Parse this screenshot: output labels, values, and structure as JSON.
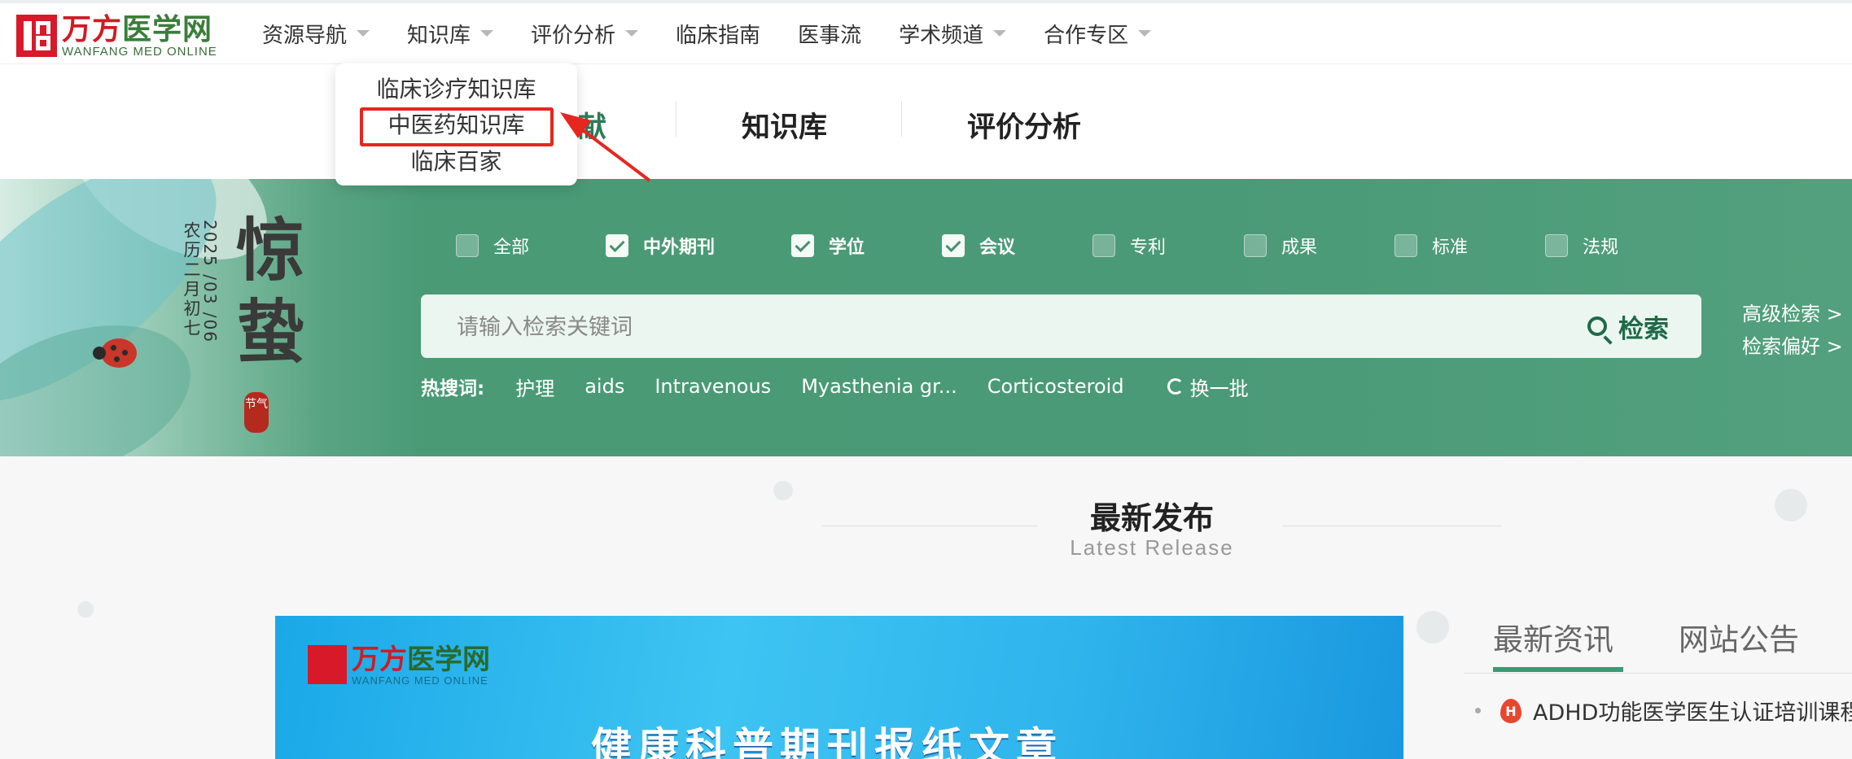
{
  "logo": {
    "cn_a": "万方",
    "cn_b": "医学网",
    "en": "WANFANG MED ONLINE"
  },
  "nav": [
    {
      "label": "资源导航",
      "caret": true
    },
    {
      "label": "知识库",
      "caret": true
    },
    {
      "label": "评价分析",
      "caret": true
    },
    {
      "label": "临床指南",
      "caret": false
    },
    {
      "label": "医事流",
      "caret": false
    },
    {
      "label": "学术频道",
      "caret": true
    },
    {
      "label": "合作专区",
      "caret": true
    }
  ],
  "tabs": {
    "first_partial": "献",
    "second": "知识库",
    "third": "评价分析"
  },
  "dropdown": {
    "items": [
      "临床诊疗知识库",
      "中医药知识库",
      "临床百家"
    ],
    "highlighted_index": 1
  },
  "banner": {
    "festival": "惊蛰",
    "date": "2025 /03 /06",
    "lunar": "农历二月初七",
    "seal": "节气"
  },
  "filters": [
    {
      "label": "全部",
      "checked": false
    },
    {
      "label": "中外期刊",
      "checked": true
    },
    {
      "label": "学位",
      "checked": true
    },
    {
      "label": "会议",
      "checked": true
    },
    {
      "label": "专利",
      "checked": false
    },
    {
      "label": "成果",
      "checked": false
    },
    {
      "label": "标准",
      "checked": false
    },
    {
      "label": "法规",
      "checked": false
    }
  ],
  "search": {
    "placeholder": "请输入检索关键词",
    "button": "检索",
    "advanced": "高级检索 >",
    "preferences": "检索偏好 >"
  },
  "hot": {
    "label": "热搜词:",
    "keywords": [
      "护理",
      "aids",
      "Intravenous",
      "Myasthenia gr...",
      "Corticosteroid"
    ],
    "refresh": "换一批"
  },
  "latest": {
    "title": "最新发布",
    "subtitle": "Latest Release"
  },
  "promo": {
    "cn_a": "万方",
    "cn_b": "医学网",
    "en": "WANFANG MED ONLINE",
    "title": "健康科普期刊报纸文章"
  },
  "news": {
    "tabs": [
      "最新资讯",
      "网站公告"
    ],
    "active_tab": 0,
    "items": [
      {
        "text": "ADHD功能医学医生认证培训课程"
      }
    ]
  },
  "colors": {
    "brand_red": "#d7192a",
    "brand_green": "#3a9a73",
    "highlight_red": "#e6261f"
  }
}
